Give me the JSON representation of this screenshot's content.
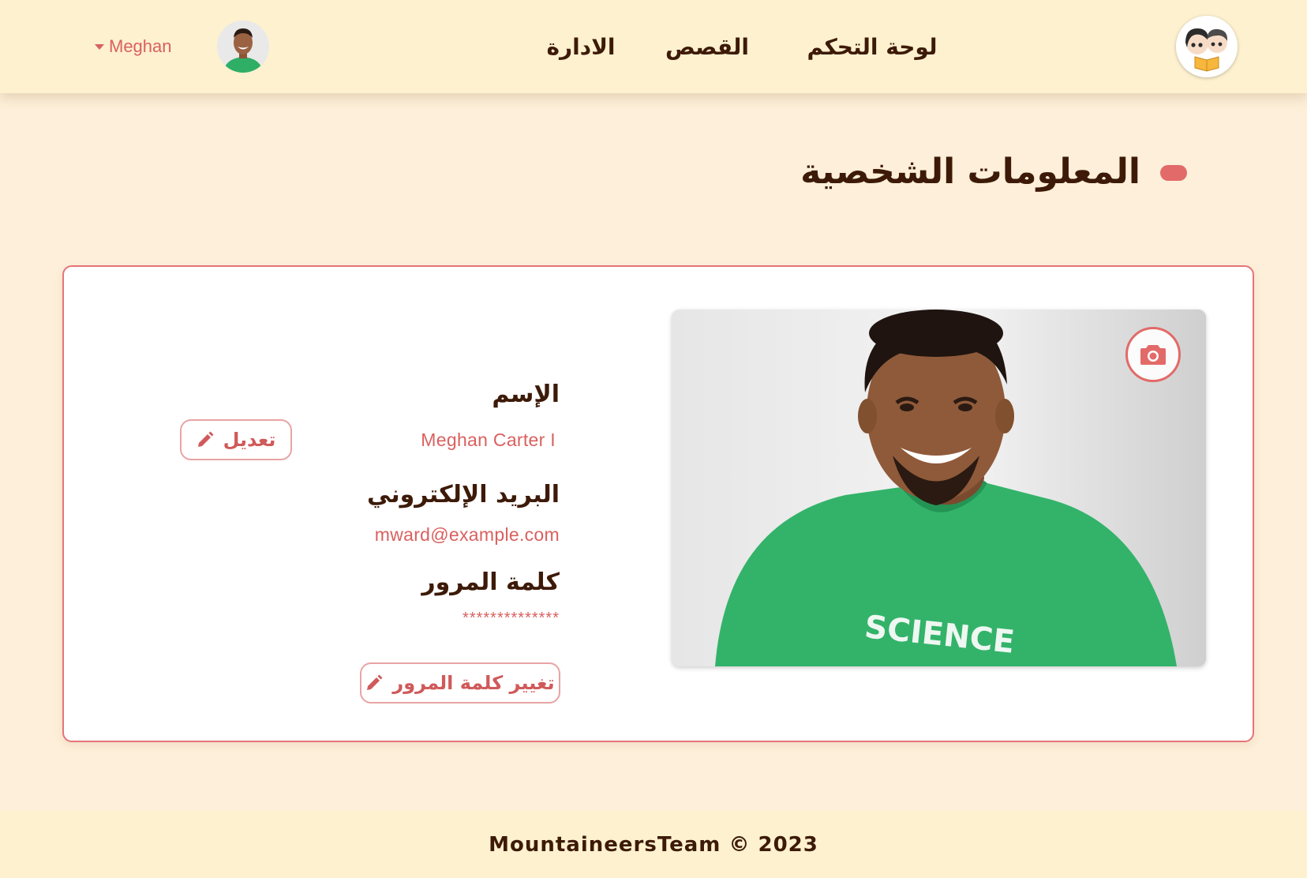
{
  "header": {
    "user_name": "Meghan",
    "nav": {
      "dashboard": "لوحة التحكم",
      "stories": "القصص",
      "admin": "الادارة"
    }
  },
  "page": {
    "title": "المعلومات الشخصية"
  },
  "profile": {
    "name_label": "الإسم",
    "name_value": "Meghan Carter I",
    "email_label": "البريد الإلكتروني",
    "email_value": "mward@example.com",
    "password_label": "كلمة المرور",
    "password_value": "**************",
    "edit_button": "تعديل",
    "change_password_button": "تغيير كلمة المرور",
    "photo_shirt_text": "SCIENCE"
  },
  "footer": {
    "text": "MountaineersTeam © 2023"
  },
  "colors": {
    "background": "#fdefd9",
    "header": "#fdf1cf",
    "accent": "#e26a68",
    "text_dark": "#3d1a08"
  },
  "icons": [
    "caret-down-icon",
    "pencil-icon",
    "camera-icon",
    "user-avatar",
    "app-logo"
  ]
}
